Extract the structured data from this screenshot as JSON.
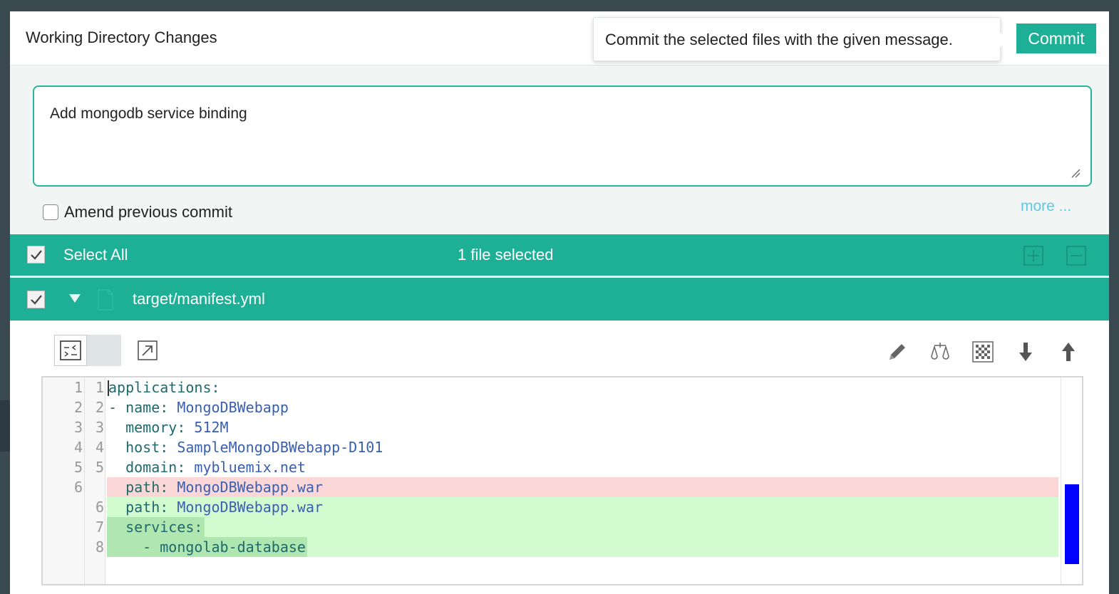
{
  "header": {
    "title": "Working Directory Changes"
  },
  "tooltip": {
    "text": "Commit the selected files with the given message."
  },
  "commit_button": {
    "label": "Commit"
  },
  "commit_message": {
    "value": "Add mongodb service binding"
  },
  "amend": {
    "label": "Amend previous commit",
    "checked": false
  },
  "more_link": {
    "label": "more ..."
  },
  "select_bar": {
    "select_all_label": "Select All",
    "selected_count": "1 file selected",
    "checked": true
  },
  "file": {
    "name": "target/manifest.yml",
    "checked": true,
    "expanded": true
  },
  "diff": {
    "lines": [
      {
        "old": "1",
        "new": "1",
        "type": "context",
        "key": "applications:",
        "value": ""
      },
      {
        "old": "2",
        "new": "2",
        "type": "context",
        "key": "- name: ",
        "value": "MongoDBWebapp"
      },
      {
        "old": "3",
        "new": "3",
        "type": "context",
        "key": "  memory: ",
        "value": "512M"
      },
      {
        "old": "4",
        "new": "4",
        "type": "context",
        "key": "  host: ",
        "value": "SampleMongoDBWebapp-D101"
      },
      {
        "old": "5",
        "new": "5",
        "type": "context",
        "key": "  domain: ",
        "value": "mybluemix.net"
      },
      {
        "old": "6",
        "new": "",
        "type": "removed",
        "key": "  path: ",
        "value": "MongoDBWebapp.war"
      },
      {
        "old": "",
        "new": "6",
        "type": "added",
        "key": "  path: ",
        "value": "MongoDBWebapp.war"
      },
      {
        "old": "",
        "new": "7",
        "type": "added",
        "key": "  services:",
        "value": ""
      },
      {
        "old": "",
        "new": "8",
        "type": "added",
        "key": "    - mongolab-database",
        "value": ""
      }
    ]
  },
  "colors": {
    "accent": "#1eb097",
    "removed_bg": "#fbd7d7",
    "added_bg": "#d2fbd0",
    "scroll_thumb": "#0000ff"
  }
}
